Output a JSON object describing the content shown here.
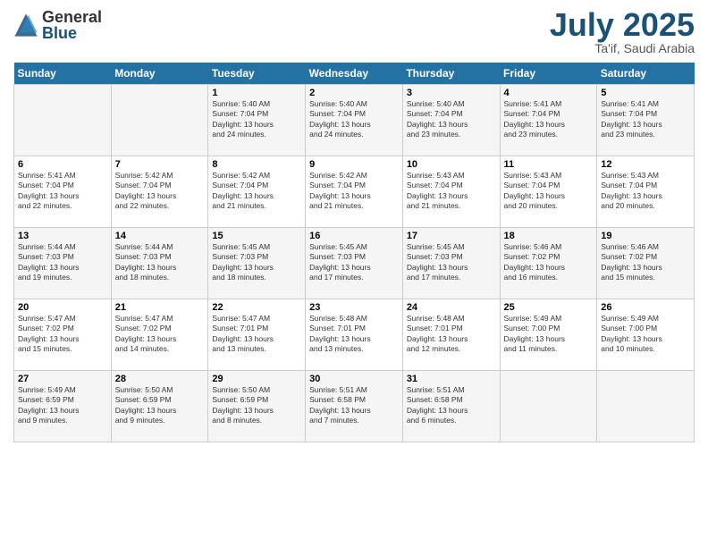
{
  "logo": {
    "general": "General",
    "blue": "Blue"
  },
  "header": {
    "month_year": "July 2025",
    "location": "Ta'if, Saudi Arabia"
  },
  "days_of_week": [
    "Sunday",
    "Monday",
    "Tuesday",
    "Wednesday",
    "Thursday",
    "Friday",
    "Saturday"
  ],
  "weeks": [
    [
      {
        "day": "",
        "info": ""
      },
      {
        "day": "",
        "info": ""
      },
      {
        "day": "1",
        "info": "Sunrise: 5:40 AM\nSunset: 7:04 PM\nDaylight: 13 hours\nand 24 minutes."
      },
      {
        "day": "2",
        "info": "Sunrise: 5:40 AM\nSunset: 7:04 PM\nDaylight: 13 hours\nand 24 minutes."
      },
      {
        "day": "3",
        "info": "Sunrise: 5:40 AM\nSunset: 7:04 PM\nDaylight: 13 hours\nand 23 minutes."
      },
      {
        "day": "4",
        "info": "Sunrise: 5:41 AM\nSunset: 7:04 PM\nDaylight: 13 hours\nand 23 minutes."
      },
      {
        "day": "5",
        "info": "Sunrise: 5:41 AM\nSunset: 7:04 PM\nDaylight: 13 hours\nand 23 minutes."
      }
    ],
    [
      {
        "day": "6",
        "info": "Sunrise: 5:41 AM\nSunset: 7:04 PM\nDaylight: 13 hours\nand 22 minutes."
      },
      {
        "day": "7",
        "info": "Sunrise: 5:42 AM\nSunset: 7:04 PM\nDaylight: 13 hours\nand 22 minutes."
      },
      {
        "day": "8",
        "info": "Sunrise: 5:42 AM\nSunset: 7:04 PM\nDaylight: 13 hours\nand 21 minutes."
      },
      {
        "day": "9",
        "info": "Sunrise: 5:42 AM\nSunset: 7:04 PM\nDaylight: 13 hours\nand 21 minutes."
      },
      {
        "day": "10",
        "info": "Sunrise: 5:43 AM\nSunset: 7:04 PM\nDaylight: 13 hours\nand 21 minutes."
      },
      {
        "day": "11",
        "info": "Sunrise: 5:43 AM\nSunset: 7:04 PM\nDaylight: 13 hours\nand 20 minutes."
      },
      {
        "day": "12",
        "info": "Sunrise: 5:43 AM\nSunset: 7:04 PM\nDaylight: 13 hours\nand 20 minutes."
      }
    ],
    [
      {
        "day": "13",
        "info": "Sunrise: 5:44 AM\nSunset: 7:03 PM\nDaylight: 13 hours\nand 19 minutes."
      },
      {
        "day": "14",
        "info": "Sunrise: 5:44 AM\nSunset: 7:03 PM\nDaylight: 13 hours\nand 18 minutes."
      },
      {
        "day": "15",
        "info": "Sunrise: 5:45 AM\nSunset: 7:03 PM\nDaylight: 13 hours\nand 18 minutes."
      },
      {
        "day": "16",
        "info": "Sunrise: 5:45 AM\nSunset: 7:03 PM\nDaylight: 13 hours\nand 17 minutes."
      },
      {
        "day": "17",
        "info": "Sunrise: 5:45 AM\nSunset: 7:03 PM\nDaylight: 13 hours\nand 17 minutes."
      },
      {
        "day": "18",
        "info": "Sunrise: 5:46 AM\nSunset: 7:02 PM\nDaylight: 13 hours\nand 16 minutes."
      },
      {
        "day": "19",
        "info": "Sunrise: 5:46 AM\nSunset: 7:02 PM\nDaylight: 13 hours\nand 15 minutes."
      }
    ],
    [
      {
        "day": "20",
        "info": "Sunrise: 5:47 AM\nSunset: 7:02 PM\nDaylight: 13 hours\nand 15 minutes."
      },
      {
        "day": "21",
        "info": "Sunrise: 5:47 AM\nSunset: 7:02 PM\nDaylight: 13 hours\nand 14 minutes."
      },
      {
        "day": "22",
        "info": "Sunrise: 5:47 AM\nSunset: 7:01 PM\nDaylight: 13 hours\nand 13 minutes."
      },
      {
        "day": "23",
        "info": "Sunrise: 5:48 AM\nSunset: 7:01 PM\nDaylight: 13 hours\nand 13 minutes."
      },
      {
        "day": "24",
        "info": "Sunrise: 5:48 AM\nSunset: 7:01 PM\nDaylight: 13 hours\nand 12 minutes."
      },
      {
        "day": "25",
        "info": "Sunrise: 5:49 AM\nSunset: 7:00 PM\nDaylight: 13 hours\nand 11 minutes."
      },
      {
        "day": "26",
        "info": "Sunrise: 5:49 AM\nSunset: 7:00 PM\nDaylight: 13 hours\nand 10 minutes."
      }
    ],
    [
      {
        "day": "27",
        "info": "Sunrise: 5:49 AM\nSunset: 6:59 PM\nDaylight: 13 hours\nand 9 minutes."
      },
      {
        "day": "28",
        "info": "Sunrise: 5:50 AM\nSunset: 6:59 PM\nDaylight: 13 hours\nand 9 minutes."
      },
      {
        "day": "29",
        "info": "Sunrise: 5:50 AM\nSunset: 6:59 PM\nDaylight: 13 hours\nand 8 minutes."
      },
      {
        "day": "30",
        "info": "Sunrise: 5:51 AM\nSunset: 6:58 PM\nDaylight: 13 hours\nand 7 minutes."
      },
      {
        "day": "31",
        "info": "Sunrise: 5:51 AM\nSunset: 6:58 PM\nDaylight: 13 hours\nand 6 minutes."
      },
      {
        "day": "",
        "info": ""
      },
      {
        "day": "",
        "info": ""
      }
    ]
  ]
}
